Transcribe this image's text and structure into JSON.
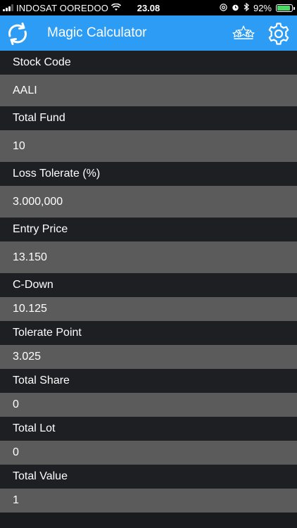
{
  "status_bar": {
    "carrier": "INDOSAT OOREDOO",
    "time": "23.08",
    "battery_percent": "92%",
    "battery_level": 0.92,
    "icons": [
      "signal-icon",
      "wifi-icon",
      "at-icon",
      "alarm-icon",
      "bluetooth-icon",
      "battery-icon"
    ]
  },
  "header": {
    "title": "Magic Calculator",
    "background": "#2c9cf5",
    "icons": [
      "refresh-icon",
      "rate-stars-icon",
      "gear-icon"
    ]
  },
  "form": {
    "fields": [
      {
        "label": "Stock Code",
        "value": "AALI"
      },
      {
        "label": "Total Fund",
        "value": "10"
      },
      {
        "label": "Loss Tolerate (%)",
        "value": "3.000,000"
      },
      {
        "label": "Entry Price",
        "value": "13.150"
      },
      {
        "label": "C-Down",
        "value": "10.125"
      },
      {
        "label": "Tolerate Point",
        "value": "3.025"
      },
      {
        "label": "Total Share",
        "value": "0"
      },
      {
        "label": "Total Lot",
        "value": "0"
      },
      {
        "label": "Total Value",
        "value": "1"
      }
    ]
  },
  "colors": {
    "label_row_bg": "#1e1f23",
    "value_row_bg": "#5b5b5b",
    "accent": "#2c9cf5",
    "battery": "#4cd964"
  }
}
